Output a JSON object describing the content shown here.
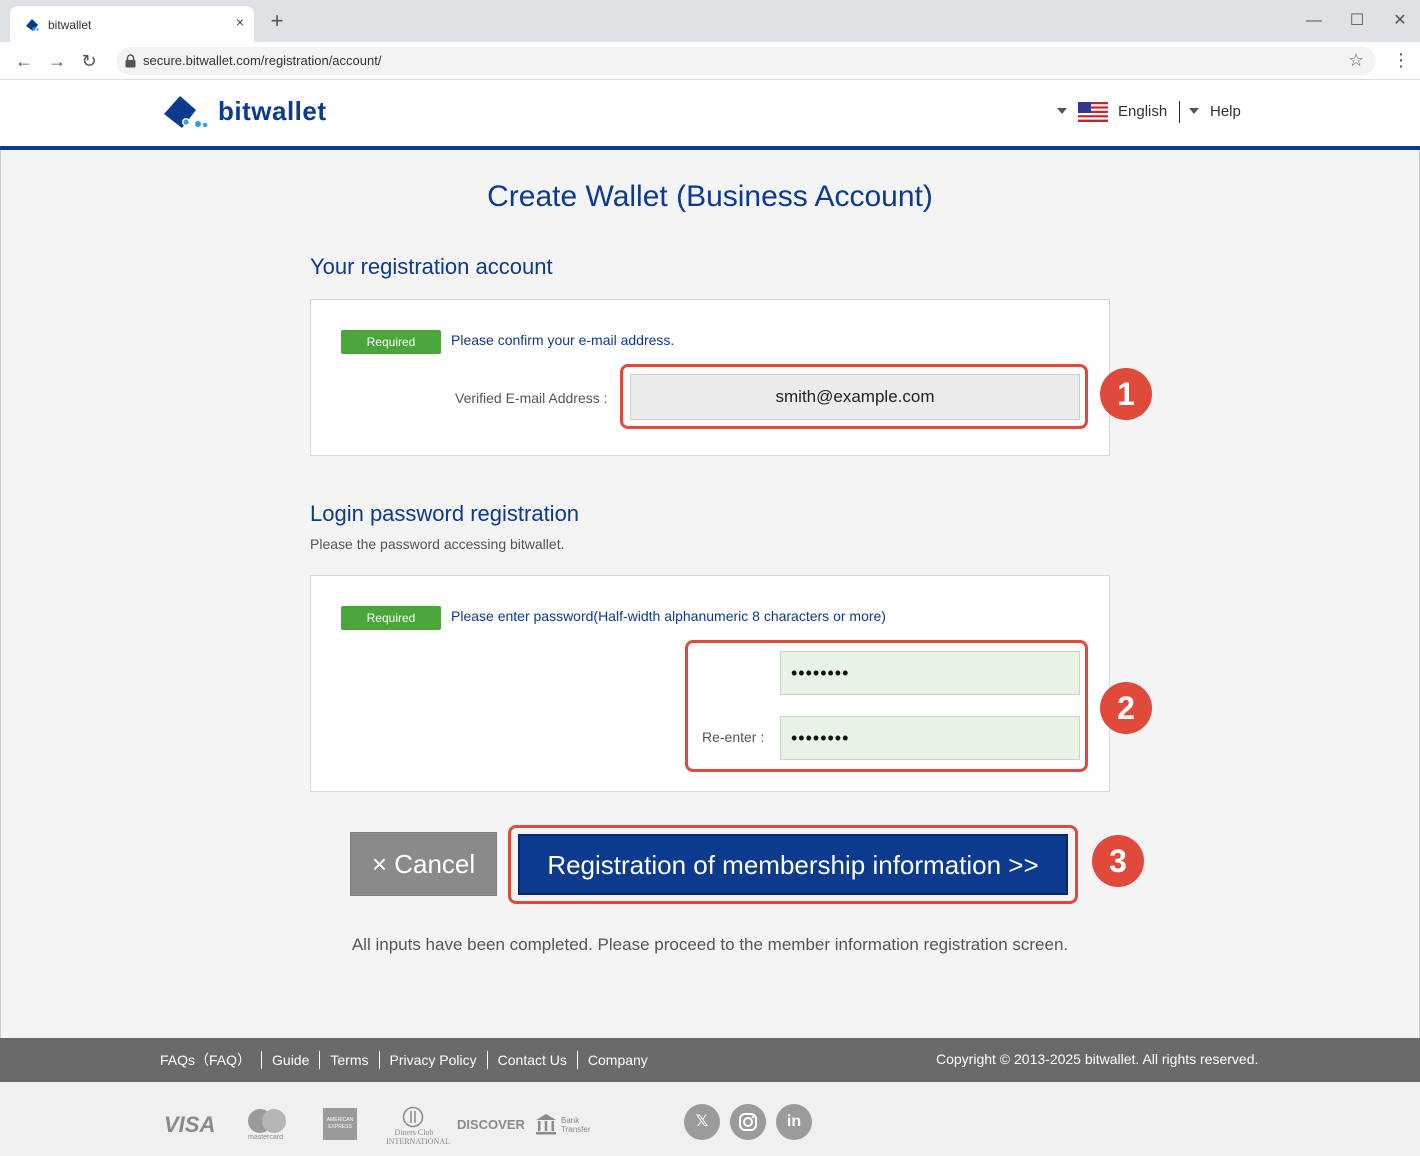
{
  "browser": {
    "tab_title": "bitwallet",
    "tab_close": "×",
    "new_tab": "+",
    "url": "secure.bitwallet.com/registration/account/",
    "icons": [
      "back-icon",
      "forward-icon",
      "reload-icon",
      "lock-icon",
      "star-icon",
      "menu-icon"
    ]
  },
  "header": {
    "logo_text": "bitwallet",
    "language": "English",
    "help": "Help",
    "brand_color": "#0b3a8f"
  },
  "main": {
    "title": "Create Wallet (Business Account)",
    "email_section": {
      "title": "Your registration account",
      "badge": "Required",
      "instruction": "Please confirm your e-mail address.",
      "label": "Verified E-mail Address :",
      "value": "smith@example.com"
    },
    "password_section": {
      "title": "Login password registration",
      "description": "Please the password accessing bitwallet.",
      "badge": "Required",
      "instruction": "Please enter password(Half-width alphanumeric 8 characters or more)",
      "password_value": "••••••••",
      "reenter_label": "Re-enter :",
      "reenter_value": "••••••••"
    },
    "cancel_label": "× Cancel",
    "submit_label": "Registration of membership information >>",
    "note": "All inputs have been completed. Please proceed to the member information registration screen.",
    "steps": [
      "1",
      "2",
      "3"
    ],
    "highlight_color": "#e04a3b",
    "badge_color": "#4aa53a"
  },
  "footer": {
    "links": [
      "FAQs（FAQ）",
      "Guide",
      "Terms",
      "Privacy Policy",
      "Contact Us",
      "Company"
    ],
    "copyright": "Copyright © 2013-2025 bitwallet. All rights reserved.",
    "payment_logos": [
      "VISA",
      "mastercard",
      "AMERICAN EXPRESS",
      "Diners Club INTERNATIONAL",
      "DISCOVER",
      "Bank Transfer"
    ],
    "social": [
      "x-icon",
      "instagram-icon",
      "linkedin-icon"
    ]
  }
}
